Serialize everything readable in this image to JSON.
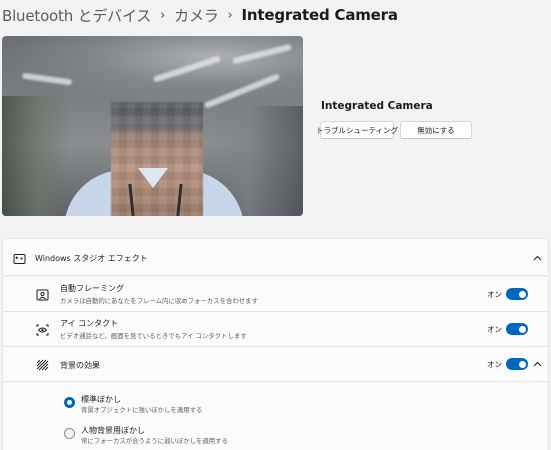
{
  "breadcrumb": {
    "items": [
      "Bluetooth とデバイス",
      "カメラ",
      "Integrated Camera"
    ],
    "separator": "›"
  },
  "camera": {
    "name": "Integrated Camera",
    "troubleshoot_label": "トラブルシューティング",
    "disable_label": "無効にする"
  },
  "studio_effects": {
    "title": "Windows スタジオ エフェクト",
    "expanded": true,
    "items": [
      {
        "title": "自動フレーミング",
        "description": "カメラは自動的にあなたをフレーム内に収めフォーカスを合わせます",
        "state_label": "オン",
        "on": true,
        "icon": "auto-framing-icon"
      },
      {
        "title": "アイ コンタクト",
        "description": "ビデオ通話など、画面を見ているときでもアイ コンタクトします",
        "state_label": "オン",
        "on": true,
        "icon": "eye-contact-icon"
      },
      {
        "title": "背景の効果",
        "state_label": "オン",
        "on": true,
        "expanded": true,
        "icon": "background-effects-icon"
      }
    ],
    "background_options": [
      {
        "title": "標準ぼかし",
        "description": "背景オブジェクトに強いぼかしを適用する",
        "selected": true
      },
      {
        "title": "人物背景用ぼかし",
        "description": "常にフォーカスが合うように弱いぼかしを適用する",
        "selected": false
      }
    ]
  },
  "colors": {
    "accent": "#0067c0",
    "background": "#f3f3f3",
    "card": "#fbfbfb"
  }
}
